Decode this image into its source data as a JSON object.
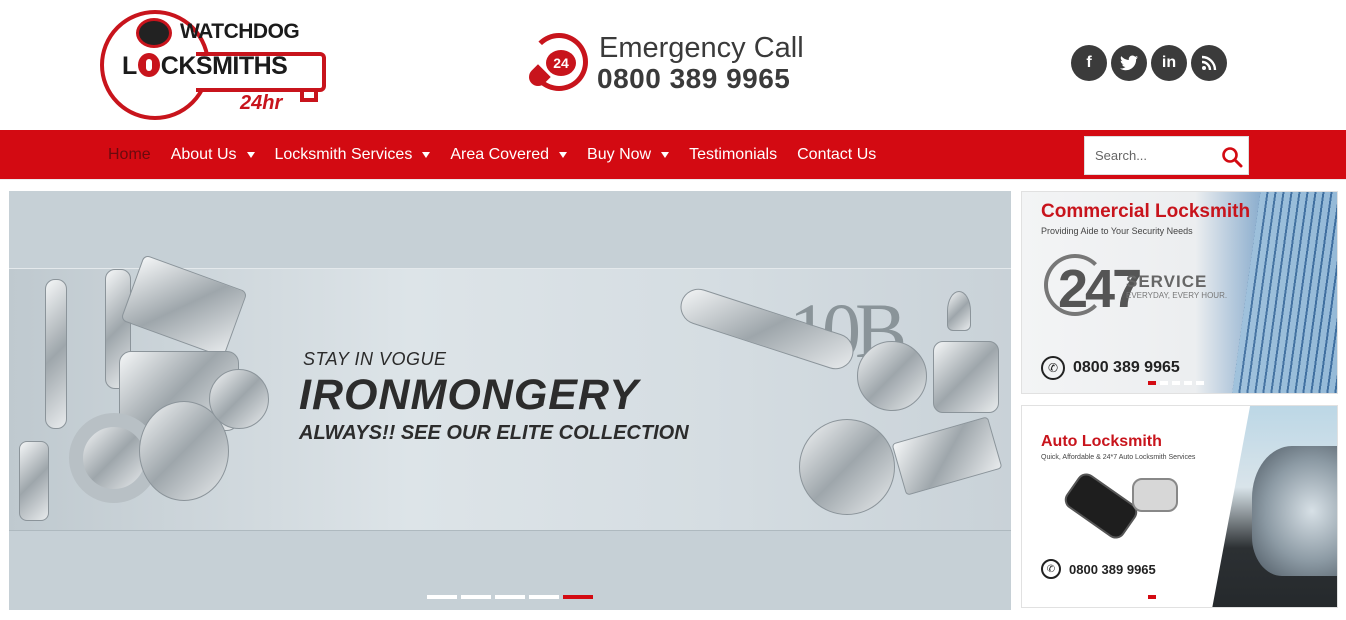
{
  "logo": {
    "top_text": "WATCHDOG",
    "main_text_a": "L",
    "main_text_b": "CKSMITHS",
    "sub_text": "24hr"
  },
  "emergency": {
    "icon_label": "24",
    "title": "Emergency Call",
    "phone": "0800 389 9965"
  },
  "social": [
    {
      "icon": "facebook-icon",
      "glyph": "f"
    },
    {
      "icon": "twitter-icon",
      "glyph": "t"
    },
    {
      "icon": "linkedin-icon",
      "glyph": "in"
    },
    {
      "icon": "rss-icon",
      "glyph": "◣"
    }
  ],
  "nav": {
    "items": [
      {
        "label": "Home",
        "dropdown": false,
        "active": true
      },
      {
        "label": "About Us",
        "dropdown": true
      },
      {
        "label": "Locksmith Services",
        "dropdown": true
      },
      {
        "label": "Area Covered",
        "dropdown": true
      },
      {
        "label": "Buy Now",
        "dropdown": true
      },
      {
        "label": "Testimonials",
        "dropdown": false
      },
      {
        "label": "Contact Us",
        "dropdown": false
      }
    ],
    "search_placeholder": "Search..."
  },
  "hero": {
    "kicker": "STAY IN VOGUE",
    "title": "IRONMONGERY",
    "subtitle": "ALWAYS!! SEE OUR ELITE COLLECTION",
    "number_sign": "10B",
    "slides_total": 5,
    "active_slide": 5
  },
  "card_commercial": {
    "title": "Commercial Locksmith",
    "subtitle": "Providing Aide to Your Security Needs",
    "badge_number": "247",
    "badge_word": "SERVICE",
    "badge_tagline": "EVERYDAY, EVERY HOUR.",
    "phone": "0800 389 9965",
    "slides_total": 5,
    "active_slide": 1
  },
  "card_auto": {
    "title": "Auto Locksmith",
    "subtitle": "Quick, Affordable & 24*7 Auto Locksmith Services",
    "phone": "0800 389 9965",
    "slides_total": 4,
    "active_slide": 1
  },
  "colors": {
    "brand_red": "#d30a12",
    "dark_text": "#3a3a3a",
    "social_bg": "#3b3b3b"
  }
}
